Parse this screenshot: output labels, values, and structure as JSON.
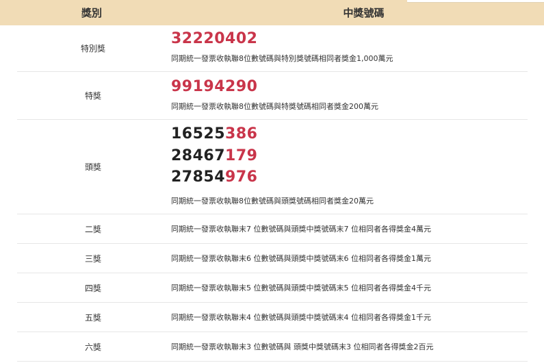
{
  "header": {
    "prize_col": "獎別",
    "numbers_col": "中獎號碼"
  },
  "colors": {
    "header_bg": "#f1dcb6",
    "winning_red": "#c9354a",
    "text_dark": "#222222",
    "row_divider": "#e6e6e6"
  },
  "rows": {
    "special": {
      "prize": "特別獎",
      "number": "32220402",
      "desc": "同期統一發票收執聯8位數號碼與特別獎號碼相同者獎金1,000萬元"
    },
    "grand": {
      "prize": "特獎",
      "number": "99194290",
      "desc": "同期統一發票收執聯8位數號碼與特獎號碼相同者獎金200萬元"
    },
    "first": {
      "prize": "頭獎",
      "numbers": [
        {
          "prefix": "16525",
          "suffix": "386"
        },
        {
          "prefix": "28467",
          "suffix": "179"
        },
        {
          "prefix": "27854",
          "suffix": "976"
        }
      ],
      "desc": "同期統一發票收執聯8位數號碼與頭獎號碼相同者獎金20萬元"
    },
    "second": {
      "prize": "二獎",
      "desc": "同期統一發票收執聯末7 位數號碼與頭獎中獎號碼末7 位相同者各得獎金4萬元"
    },
    "third": {
      "prize": "三獎",
      "desc": "同期統一發票收執聯末6 位數號碼與頭獎中獎號碼末6 位相同者各得獎金1萬元"
    },
    "fourth": {
      "prize": "四獎",
      "desc": "同期統一發票收執聯末5 位數號碼與頭獎中獎號碼末5 位相同者各得獎金4千元"
    },
    "fifth": {
      "prize": "五獎",
      "desc": "同期統一發票收執聯末4 位數號碼與頭獎中獎號碼末4 位相同者各得獎金1千元"
    },
    "sixth": {
      "prize": "六獎",
      "desc": "同期統一發票收執聯末3 位數號碼與 頭獎中獎號碼末3 位相同者各得獎金2百元"
    }
  }
}
